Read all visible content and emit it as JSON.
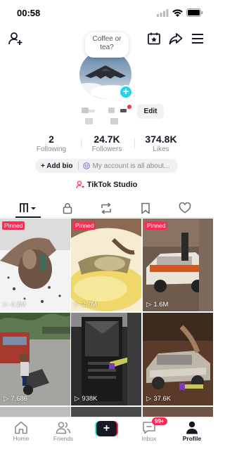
{
  "status_bar": {
    "time": "00:58"
  },
  "profile": {
    "note": "Coffee or tea?",
    "edit_label": "Edit",
    "stats": [
      {
        "value": "2",
        "label": "Following"
      },
      {
        "value": "24.7K",
        "label": "Followers"
      },
      {
        "value": "374.8K",
        "label": "Likes"
      }
    ],
    "add_bio_label": "+ Add bio",
    "note_text": "My account is all about...",
    "studio_label": "TikTok Studio"
  },
  "videos": [
    {
      "pinned": "Pinned",
      "views": "4.2M"
    },
    {
      "pinned": "Pinned",
      "views": "2.7M"
    },
    {
      "pinned": "Pinned",
      "views": "1.6M"
    },
    {
      "pinned": "",
      "views": "7,686"
    },
    {
      "pinned": "",
      "views": "938K"
    },
    {
      "pinned": "",
      "views": "37.6K"
    }
  ],
  "bottom_nav": {
    "home": "Home",
    "friends": "Friends",
    "inbox": "Inbox",
    "inbox_badge": "99+",
    "profile": "Profile"
  },
  "colors": {
    "accent": "#fe2c55",
    "cyan": "#25f4ee",
    "avatar_plus": "#20d5ec"
  }
}
